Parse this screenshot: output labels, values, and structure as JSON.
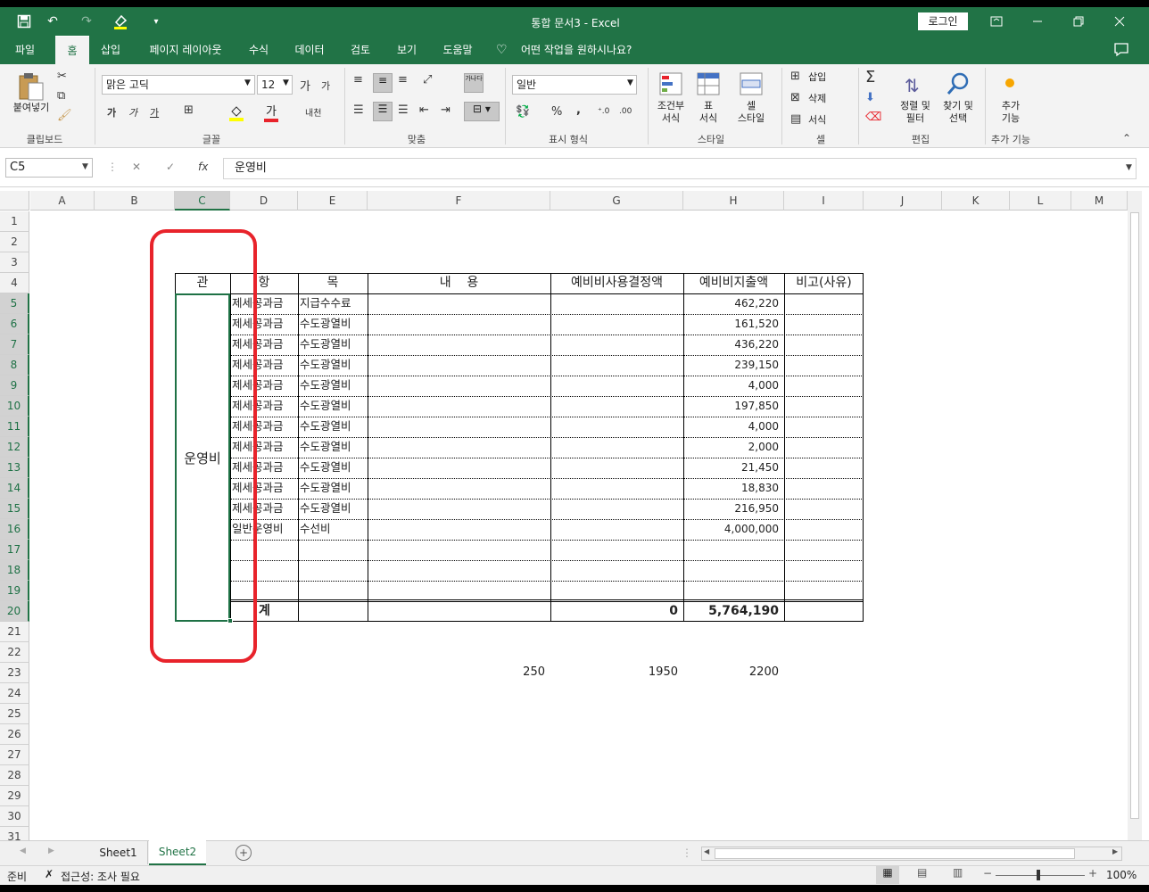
{
  "window": {
    "title": "통합 문서3  -  Excel",
    "login": "로그인",
    "qat_more": "▾"
  },
  "menu": {
    "tabs": [
      "파일",
      "홈",
      "삽입",
      "페이지 레이아웃",
      "수식",
      "데이터",
      "검토",
      "보기",
      "도움말"
    ],
    "tell_me": "어떤 작업을 원하시나요?"
  },
  "ribbon": {
    "clipboard": {
      "paste": "붙여넣기",
      "label": "클립보드"
    },
    "font": {
      "name": "맑은 고딕",
      "size": "12",
      "grow": "가",
      "shrink": "가",
      "bold": "가",
      "italic": "가",
      "underline": "가",
      "phonetic": "내천",
      "label": "글꼴"
    },
    "align": {
      "wrap": "가나다",
      "label": "맞춤"
    },
    "number": {
      "format": "일반",
      "percent": "%",
      "comma": ",",
      "label": "표시 형식"
    },
    "styles": {
      "cond1": "조건부",
      "cond2": "서식",
      "table1": "표",
      "table2": "서식",
      "cell1": "셀",
      "cell2": "스타일",
      "label": "스타일"
    },
    "cells": {
      "insert": "삽입",
      "delete": "삭제",
      "format": "서식",
      "label": "셀"
    },
    "editing": {
      "sort1": "정렬 및",
      "sort2": "필터",
      "find1": "찾기 및",
      "find2": "선택",
      "label": "편집"
    },
    "addins": {
      "l1": "추가",
      "l2": "기능",
      "label": "추가 기능"
    }
  },
  "formula_bar": {
    "name_box": "C5",
    "fx": "fx",
    "content": "운영비"
  },
  "columns": [
    "A",
    "B",
    "C",
    "D",
    "E",
    "F",
    "G",
    "H",
    "I",
    "J",
    "K",
    "L",
    "M"
  ],
  "rows": [
    "1",
    "2",
    "3",
    "4",
    "5",
    "6",
    "7",
    "8",
    "9",
    "10",
    "11",
    "12",
    "13",
    "14",
    "15",
    "16",
    "17",
    "18",
    "19",
    "20",
    "21",
    "22",
    "23",
    "24",
    "25",
    "26",
    "27",
    "28",
    "29",
    "30",
    "31"
  ],
  "table": {
    "headers": {
      "c": "관",
      "d": "항",
      "e": "목",
      "f": "내    용",
      "g": "예비비사용결정액",
      "h": "예비비지출액",
      "i": "비고(사유)"
    },
    "merged_c": "운영비",
    "data": [
      {
        "d": "제세공과금",
        "e": "지급수수료",
        "h": "462,220"
      },
      {
        "d": "제세공과금",
        "e": "수도광열비",
        "h": "161,520"
      },
      {
        "d": "제세공과금",
        "e": "수도광열비",
        "h": "436,220"
      },
      {
        "d": "제세공과금",
        "e": "수도광열비",
        "h": "239,150"
      },
      {
        "d": "제세공과금",
        "e": "수도광열비",
        "h": "4,000"
      },
      {
        "d": "제세공과금",
        "e": "수도광열비",
        "h": "197,850"
      },
      {
        "d": "제세공과금",
        "e": "수도광열비",
        "h": "4,000"
      },
      {
        "d": "제세공과금",
        "e": "수도광열비",
        "h": "2,000"
      },
      {
        "d": "제세공과금",
        "e": "수도광열비",
        "h": "21,450"
      },
      {
        "d": "제세공과금",
        "e": "수도광열비",
        "h": "18,830"
      },
      {
        "d": "제세공과금",
        "e": "수도광열비",
        "h": "216,950"
      },
      {
        "d": "일반운영비",
        "e": "수선비",
        "h": "4,000,000"
      }
    ],
    "total": {
      "label": "계",
      "g": "0",
      "h": "5,764,190"
    },
    "row23": {
      "f": "250",
      "g": "1950",
      "h": "2200"
    }
  },
  "sheets": {
    "tabs": [
      "Sheet1",
      "Sheet2"
    ],
    "active": "Sheet2",
    "add": "+"
  },
  "status": {
    "ready": "준비",
    "accessibility": "접근성: 조사 필요",
    "zoom": "100%"
  },
  "colors": {
    "excel_green": "#217346",
    "highlight": "#e8232b",
    "selection": "#1e7145"
  }
}
